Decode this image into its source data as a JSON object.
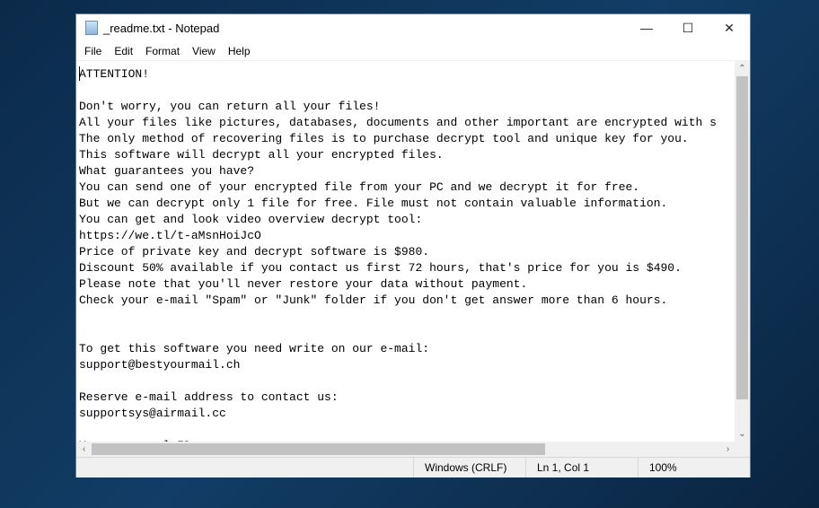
{
  "window": {
    "title": "_readme.txt - Notepad",
    "minimize": "—",
    "maximize": "☐",
    "close": "✕"
  },
  "menu": [
    "File",
    "Edit",
    "Format",
    "View",
    "Help"
  ],
  "content": "ATTENTION!\n\nDon't worry, you can return all your files!\nAll your files like pictures, databases, documents and other important are encrypted with s\nThe only method of recovering files is to purchase decrypt tool and unique key for you.\nThis software will decrypt all your encrypted files.\nWhat guarantees you have?\nYou can send one of your encrypted file from your PC and we decrypt it for free.\nBut we can decrypt only 1 file for free. File must not contain valuable information.\nYou can get and look video overview decrypt tool:\nhttps://we.tl/t-aMsnHoiJcO\nPrice of private key and decrypt software is $980.\nDiscount 50% available if you contact us first 72 hours, that's price for you is $490.\nPlease note that you'll never restore your data without payment.\nCheck your e-mail \"Spam\" or \"Junk\" folder if you don't get answer more than 6 hours.\n\n\nTo get this software you need write on our e-mail:\nsupport@bestyourmail.ch\n\nReserve e-mail address to contact us:\nsupportsys@airmail.cc\n\nYour personal ID:",
  "status": {
    "line_ending": "Windows (CRLF)",
    "position": "Ln 1, Col 1",
    "zoom": "100%"
  }
}
